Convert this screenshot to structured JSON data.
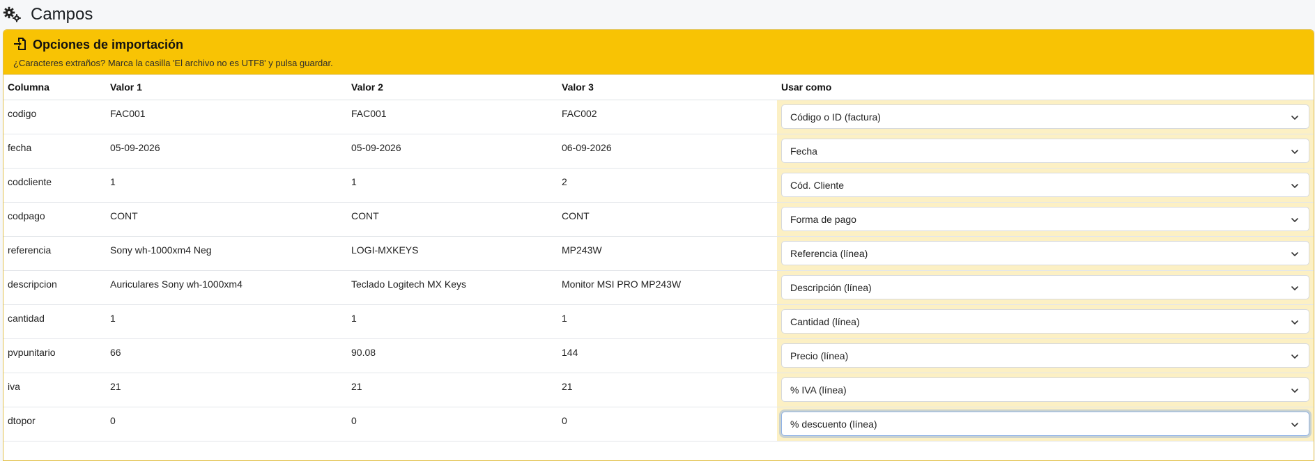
{
  "page": {
    "title": "Campos"
  },
  "card": {
    "title": "Opciones de importación",
    "note": "¿Caracteres extraños? Marca la casilla 'El archivo no es UTF8' y pulsa guardar."
  },
  "table": {
    "headers": [
      "Columna",
      "Valor 1",
      "Valor 2",
      "Valor 3",
      "Usar como"
    ],
    "rows": [
      {
        "column": "codigo",
        "v1": "FAC001",
        "v2": "FAC001",
        "v3": "FAC002",
        "use": "Código o ID (factura)"
      },
      {
        "column": "fecha",
        "v1": "05-09-2026",
        "v2": "05-09-2026",
        "v3": "06-09-2026",
        "use": "Fecha"
      },
      {
        "column": "codcliente",
        "v1": "1",
        "v2": "1",
        "v3": "2",
        "use": "Cód. Cliente"
      },
      {
        "column": "codpago",
        "v1": "CONT",
        "v2": "CONT",
        "v3": "CONT",
        "use": "Forma de pago"
      },
      {
        "column": "referencia",
        "v1": "Sony wh-1000xm4 Neg",
        "v2": "LOGI-MXKEYS",
        "v3": "MP243W",
        "use": "Referencia (línea)"
      },
      {
        "column": "descripcion",
        "v1": "Auriculares Sony wh-1000xm4",
        "v2": "Teclado Logitech MX Keys",
        "v3": "Monitor MSI PRO MP243W",
        "use": "Descripción (línea)"
      },
      {
        "column": "cantidad",
        "v1": "1",
        "v2": "1",
        "v3": "1",
        "use": "Cantidad (línea)"
      },
      {
        "column": "pvpunitario",
        "v1": "66",
        "v2": "90.08",
        "v3": "144",
        "use": "Precio (línea)"
      },
      {
        "column": "iva",
        "v1": "21",
        "v2": "21",
        "v3": "21",
        "use": "% IVA (línea)"
      },
      {
        "column": "dtopor",
        "v1": "0",
        "v2": "0",
        "v3": "0",
        "use": "% descuento (línea)"
      }
    ]
  },
  "icons": {
    "page": "gears-icon",
    "card": "file-import-icon",
    "select": "chevron-down-icon"
  },
  "colors": {
    "header_bg": "#f8c304",
    "use_col_bg": "#fcf0c4",
    "focus": "#8fb2e6"
  }
}
